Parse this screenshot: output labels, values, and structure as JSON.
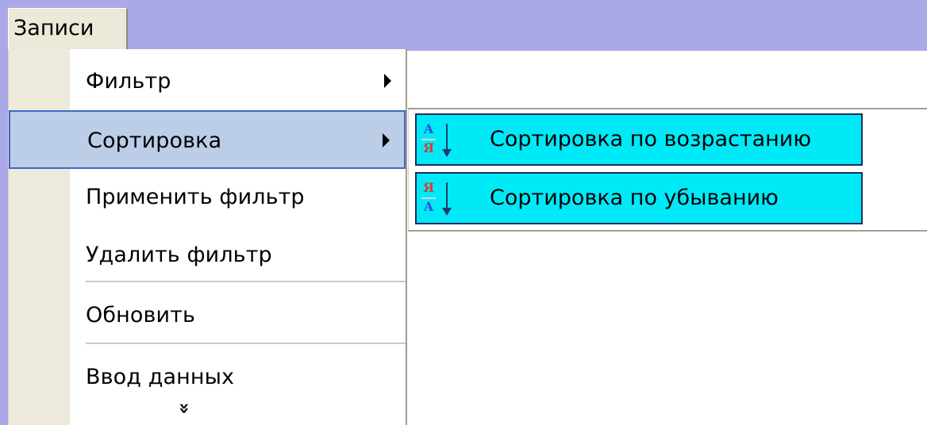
{
  "menu_bar": {
    "records_label": "Записи"
  },
  "dropdown": {
    "items": [
      {
        "label": "Фильтр",
        "has_submenu": true
      },
      {
        "label": "Сортировка",
        "has_submenu": true,
        "selected": true
      },
      {
        "label": "Применить фильтр"
      },
      {
        "label": "Удалить фильтр"
      },
      {
        "label": "Обновить"
      },
      {
        "label": "Ввод данных"
      }
    ],
    "more_icon": "double-chevron-down-icon"
  },
  "submenu": {
    "items": [
      {
        "label": "Сортировка по возрастанию",
        "icon": "sort-ascending-icon",
        "top_letter": "А",
        "bottom_letter": "Я"
      },
      {
        "label": "Сортировка по убыванию",
        "icon": "sort-descending-icon",
        "top_letter": "Я",
        "bottom_letter": "А"
      }
    ]
  },
  "colors": {
    "desktop_band": "#aaa8e6",
    "selected_highlight": "#bccde8",
    "submenu_highlight": "#00e9f7",
    "icon_blue": "#2f51d5",
    "icon_red": "#d43f36"
  }
}
